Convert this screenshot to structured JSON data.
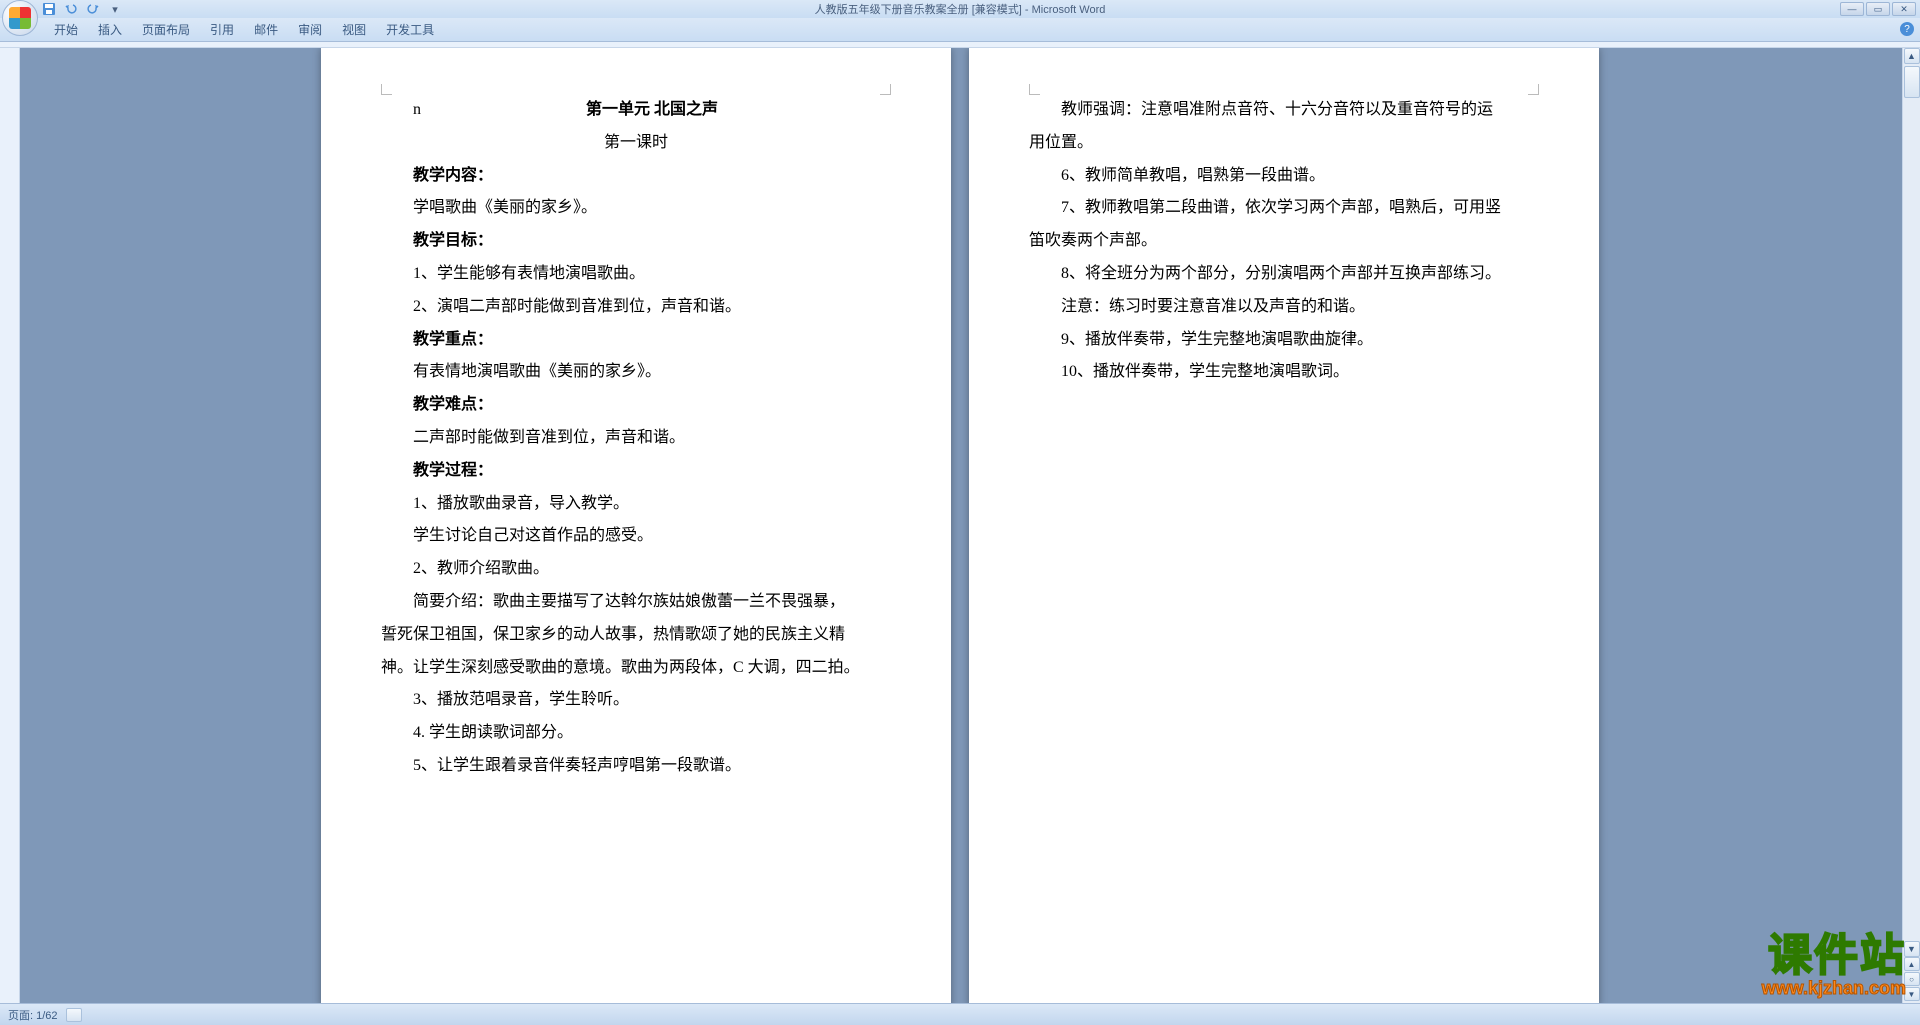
{
  "title": "人教版五年级下册音乐教案全册 [兼容模式] - Microsoft Word",
  "ribbon": {
    "tabs": [
      "开始",
      "插入",
      "页面布局",
      "引用",
      "邮件",
      "审阅",
      "视图",
      "开发工具"
    ]
  },
  "status": {
    "page": "页面: 1/62"
  },
  "watermark": {
    "line1": "课件站",
    "line2": "www.kjzhan.com"
  },
  "docLeft": {
    "n": "n",
    "unitTitle": "第一单元  北国之声",
    "lessonTitle": "第一课时",
    "h_content": "教学内容：",
    "p_content1": "学唱歌曲《美丽的家乡》。",
    "h_goal": "教学目标：",
    "p_goal1": "1、学生能够有表情地演唱歌曲。",
    "p_goal2": "2、演唱二声部时能做到音准到位，声音和谐。",
    "h_focus": "教学重点：",
    "p_focus1": "有表情地演唱歌曲《美丽的家乡》。",
    "h_hard": "教学难点：",
    "p_hard1": "二声部时能做到音准到位，声音和谐。",
    "h_proc": "教学过程：",
    "p_proc1": "1、播放歌曲录音，导入教学。",
    "p_proc2": "学生讨论自己对这首作品的感受。",
    "p_proc3": "2、教师介绍歌曲。",
    "p_proc4": "简要介绍：歌曲主要描写了达斡尔族姑娘傲蕾一兰不畏强暴，",
    "p_proc5": "誓死保卫祖国，保卫家乡的动人故事，热情歌颂了她的民族主义精",
    "p_proc6": "神。让学生深刻感受歌曲的意境。歌曲为两段体，C 大调，四二拍。",
    "p_proc7": "3、播放范唱录音，学生聆听。",
    "p_proc8": "4. 学生朗读歌词部分。",
    "p_proc9": "5、让学生跟着录音伴奏轻声哼唱第一段歌谱。"
  },
  "docRight": {
    "p1": "教师强调：注意唱准附点音符、十六分音符以及重音符号的运",
    "p2": "用位置。",
    "p3": "6、教师简单教唱，唱熟第一段曲谱。",
    "p4": "7、教师教唱第二段曲谱，依次学习两个声部，唱熟后，可用竖",
    "p5": "笛吹奏两个声部。",
    "p6": "8、将全班分为两个部分，分别演唱两个声部并互换声部练习。",
    "p7": "注意：练习时要注意音准以及声音的和谐。",
    "p8": "9、播放伴奏带，学生完整地演唱歌曲旋律。",
    "p9": "10、播放伴奏带，学生完整地演唱歌词。"
  }
}
